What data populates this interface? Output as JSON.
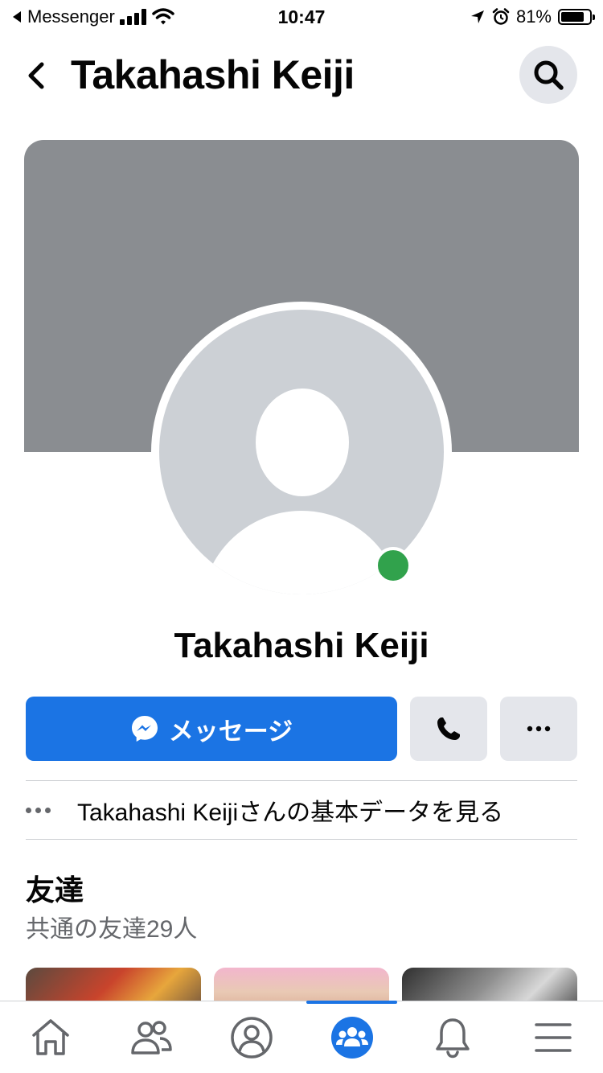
{
  "status_bar": {
    "back_app": "Messenger",
    "time": "10:47",
    "battery": "81%",
    "battery_level": 0.81
  },
  "header": {
    "title": "Takahashi Keiji"
  },
  "profile": {
    "name": "Takahashi Keiji",
    "online": true
  },
  "actions": {
    "message_label": "メッセージ"
  },
  "info": {
    "about_link": "Takahashi Keijiさんの基本データを見る"
  },
  "friends": {
    "title": "友達",
    "mutual": "共通の友達29人"
  },
  "bottom_nav": {
    "items": [
      "home",
      "friends",
      "profile",
      "groups",
      "notifications",
      "menu"
    ],
    "active": "groups"
  },
  "colors": {
    "accent": "#1b74e4",
    "online": "#31a24c",
    "cover": "#8a8d91",
    "button_gray": "#e4e6eb"
  }
}
